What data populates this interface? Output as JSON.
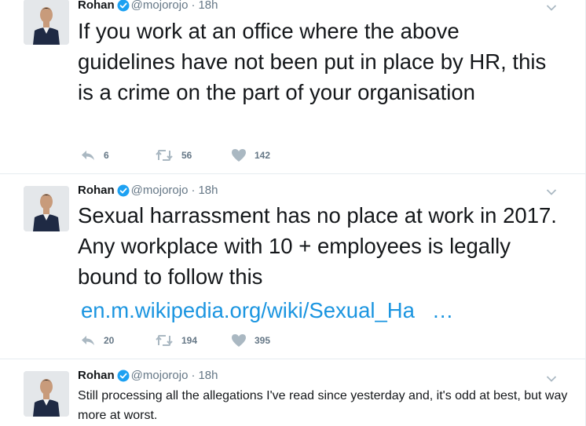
{
  "tweets": [
    {
      "name": "Rohan",
      "handle": "@mojorojo",
      "sep": "·",
      "time": "18h",
      "text": "If you work at an office where the above guidelines have not been put in place by HR, this is a crime on the part of your organisation",
      "replies": "6",
      "retweets": "56",
      "likes": "142"
    },
    {
      "name": "Rohan",
      "handle": "@mojorojo",
      "sep": "·",
      "time": "18h",
      "text": "Sexual harrassment has no place at work in 2017. Any workplace with 10 + employees is legally bound to follow this",
      "link": "en.m.wikipedia.org/wiki/Sexual_Ha",
      "link_ellipsis": "…",
      "replies": "20",
      "retweets": "194",
      "likes": "395"
    },
    {
      "name": "Rohan",
      "handle": "@mojorojo",
      "sep": "·",
      "time": "18h",
      "text": "Still processing all the allegations I've read since yesterday and, it's odd at best, but way more at worst."
    }
  ],
  "colors": {
    "link": "#1b95e0",
    "muted": "#657786",
    "text": "#14171a",
    "verified": "#1da1f2",
    "divider": "#e6ecf0"
  },
  "icons": [
    "avatar",
    "verified-icon",
    "caret-down-icon",
    "reply-icon",
    "retweet-icon",
    "like-icon"
  ]
}
